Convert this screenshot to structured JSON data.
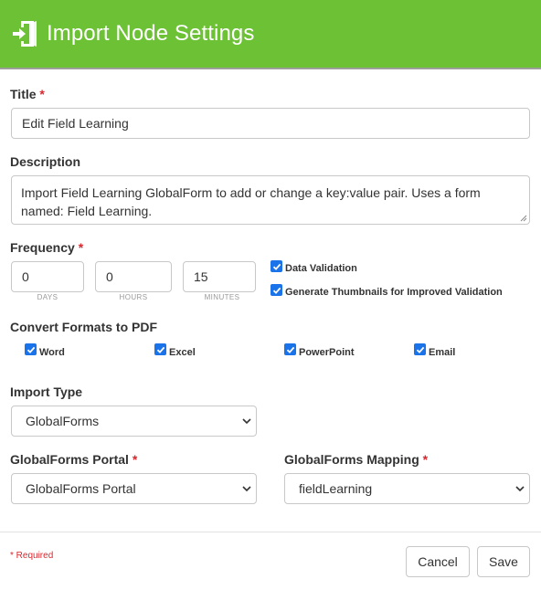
{
  "header": {
    "title": "Import Node Settings",
    "icon": "import-door-icon"
  },
  "title_field": {
    "label": "Title",
    "required_mark": "*",
    "value": "Edit Field Learning"
  },
  "description": {
    "label": "Description",
    "value": "Import Field Learning GlobalForm to add or change a key:value pair.  Uses a form named: Field Learning."
  },
  "frequency": {
    "label": "Frequency",
    "required_mark": "*",
    "days": {
      "value": "0",
      "unit": "DAYS"
    },
    "hours": {
      "value": "0",
      "unit": "HOURS"
    },
    "minutes": {
      "value": "15",
      "unit": "MINUTES"
    }
  },
  "options": {
    "data_validation": {
      "label": "Data Validation",
      "checked": true
    },
    "thumbnails": {
      "label": "Generate Thumbnails for Improved Validation",
      "checked": true
    }
  },
  "convert": {
    "label": "Convert Formats to PDF",
    "items": [
      {
        "label": "Word",
        "checked": true
      },
      {
        "label": "Excel",
        "checked": true
      },
      {
        "label": "PowerPoint",
        "checked": true
      },
      {
        "label": "Email",
        "checked": true
      }
    ]
  },
  "import_type": {
    "label": "Import Type",
    "value": "GlobalForms"
  },
  "portal": {
    "label": "GlobalForms Portal",
    "required_mark": "*",
    "value": "GlobalForms Portal"
  },
  "mapping": {
    "label": "GlobalForms Mapping",
    "required_mark": "*",
    "value": "fieldLearning"
  },
  "footer": {
    "required_note": "* Required",
    "cancel_label": "Cancel",
    "save_label": "Save"
  },
  "colors": {
    "header": "#6cc134",
    "checkbox": "#1a73e8",
    "required": "#d9272e"
  }
}
